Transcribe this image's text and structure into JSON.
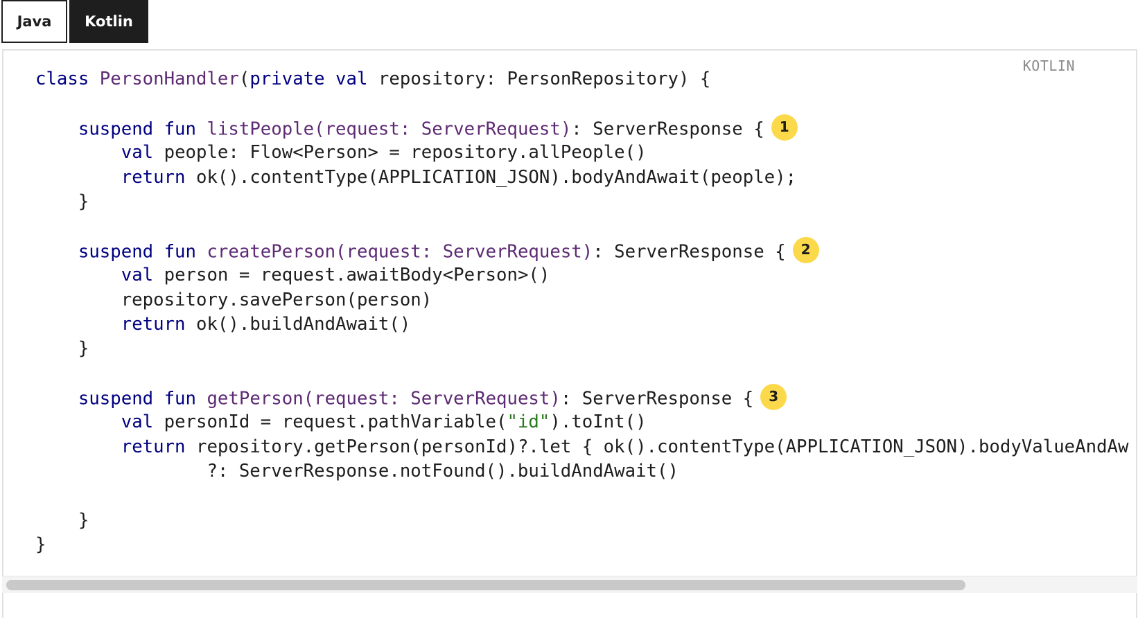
{
  "tabs": [
    {
      "label": "Java",
      "active": false
    },
    {
      "label": "Kotlin",
      "active": true
    }
  ],
  "code_block": {
    "language_label": "KOTLIN",
    "lines": [
      {
        "tokens": [
          {
            "t": "k",
            "v": "class "
          },
          {
            "t": "f",
            "v": "PersonHandler"
          },
          {
            "t": "",
            "v": "("
          },
          {
            "t": "k",
            "v": "private val"
          },
          {
            "t": "",
            "v": " repository: PersonRepository) {"
          }
        ]
      },
      {
        "tokens": []
      },
      {
        "tokens": [
          {
            "t": "",
            "v": "    "
          },
          {
            "t": "k",
            "v": "suspend fun "
          },
          {
            "t": "f",
            "v": "listPeople(request: ServerRequest)"
          },
          {
            "t": "",
            "v": ": ServerResponse {"
          }
        ],
        "callout": "1"
      },
      {
        "tokens": [
          {
            "t": "",
            "v": "        "
          },
          {
            "t": "k",
            "v": "val"
          },
          {
            "t": "",
            "v": " people: Flow<Person> = repository.allPeople()"
          }
        ]
      },
      {
        "tokens": [
          {
            "t": "",
            "v": "        "
          },
          {
            "t": "k",
            "v": "return"
          },
          {
            "t": "",
            "v": " ok().contentType(APPLICATION_JSON).bodyAndAwait(people);"
          }
        ]
      },
      {
        "tokens": [
          {
            "t": "",
            "v": "    }"
          }
        ]
      },
      {
        "tokens": []
      },
      {
        "tokens": [
          {
            "t": "",
            "v": "    "
          },
          {
            "t": "k",
            "v": "suspend fun "
          },
          {
            "t": "f",
            "v": "createPerson(request: ServerRequest)"
          },
          {
            "t": "",
            "v": ": ServerResponse {"
          }
        ],
        "callout": "2"
      },
      {
        "tokens": [
          {
            "t": "",
            "v": "        "
          },
          {
            "t": "k",
            "v": "val"
          },
          {
            "t": "",
            "v": " person = request.awaitBody<Person>()"
          }
        ]
      },
      {
        "tokens": [
          {
            "t": "",
            "v": "        repository.savePerson(person)"
          }
        ]
      },
      {
        "tokens": [
          {
            "t": "",
            "v": "        "
          },
          {
            "t": "k",
            "v": "return"
          },
          {
            "t": "",
            "v": " ok().buildAndAwait()"
          }
        ]
      },
      {
        "tokens": [
          {
            "t": "",
            "v": "    }"
          }
        ]
      },
      {
        "tokens": []
      },
      {
        "tokens": [
          {
            "t": "",
            "v": "    "
          },
          {
            "t": "k",
            "v": "suspend fun "
          },
          {
            "t": "f",
            "v": "getPerson(request: ServerRequest)"
          },
          {
            "t": "",
            "v": ": ServerResponse {"
          }
        ],
        "callout": "3"
      },
      {
        "tokens": [
          {
            "t": "",
            "v": "        "
          },
          {
            "t": "k",
            "v": "val"
          },
          {
            "t": "",
            "v": " personId = request.pathVariable("
          },
          {
            "t": "s",
            "v": "\"id\""
          },
          {
            "t": "",
            "v": ").toInt()"
          }
        ]
      },
      {
        "tokens": [
          {
            "t": "",
            "v": "        "
          },
          {
            "t": "k",
            "v": "return"
          },
          {
            "t": "",
            "v": " repository.getPerson(personId)?.let { ok().contentType(APPLICATION_JSON).bodyValueAndAw"
          }
        ]
      },
      {
        "tokens": [
          {
            "t": "",
            "v": "                ?: ServerResponse.notFound().buildAndAwait()"
          }
        ]
      },
      {
        "tokens": []
      },
      {
        "tokens": [
          {
            "t": "",
            "v": "    }"
          }
        ]
      },
      {
        "tokens": [
          {
            "t": "",
            "v": "}"
          }
        ]
      }
    ]
  },
  "colors": {
    "keyword": "#000080",
    "function": "#5d2a73",
    "string": "#2a7a1e",
    "callout": "#fbd94a",
    "active_tab": "#1e1e1e"
  }
}
